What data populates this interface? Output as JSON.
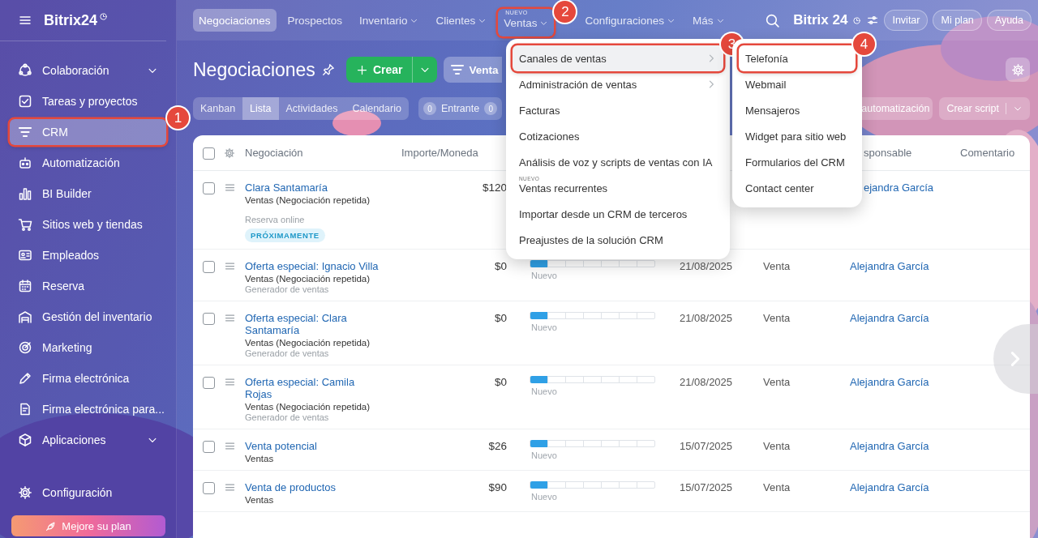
{
  "sidebar": {
    "logo": "Bitrix24",
    "items": [
      {
        "label": "Colaboración",
        "expandable": true,
        "selected": false
      },
      {
        "label": "Tareas y proyectos",
        "expandable": false,
        "selected": false
      },
      {
        "label": "CRM",
        "expandable": false,
        "selected": true,
        "callout": "1"
      },
      {
        "label": "Automatización",
        "expandable": false,
        "selected": false
      },
      {
        "label": "BI Builder",
        "expandable": false,
        "selected": false
      },
      {
        "label": "Sitios web y tiendas",
        "expandable": false,
        "selected": false
      },
      {
        "label": "Empleados",
        "expandable": false,
        "selected": false
      },
      {
        "label": "Reserva",
        "expandable": false,
        "selected": false
      },
      {
        "label": "Gestión del inventario",
        "expandable": false,
        "selected": false
      },
      {
        "label": "Marketing",
        "expandable": false,
        "selected": false
      },
      {
        "label": "Firma electrónica",
        "expandable": false,
        "selected": false
      },
      {
        "label": "Firma electrónica para...",
        "expandable": false,
        "selected": false
      },
      {
        "label": "Aplicaciones",
        "expandable": true,
        "selected": false
      }
    ],
    "settings": "Configuración",
    "upgrade": "Mejore su plan"
  },
  "topnav": {
    "items": [
      {
        "label": "Negociaciones",
        "selected": true,
        "dropdown": false
      },
      {
        "label": "Prospectos",
        "selected": false,
        "dropdown": false
      },
      {
        "label": "Inventario",
        "selected": false,
        "dropdown": true
      },
      {
        "label": "Clientes",
        "selected": false,
        "dropdown": true
      },
      {
        "label": "Ventas",
        "selected": false,
        "dropdown": true,
        "badge": "NUEVO",
        "callout": "2"
      },
      {
        "label": "Configuraciones",
        "selected": false,
        "dropdown": true
      },
      {
        "label": "Más",
        "selected": false,
        "dropdown": true
      }
    ],
    "brand": "Bitrix 24",
    "buttons": [
      "Invitar",
      "Mi plan",
      "Ayuda"
    ]
  },
  "header": {
    "title": "Negociaciones",
    "create": "Crear",
    "filter": "Venta"
  },
  "views": [
    {
      "label": "Kanban",
      "selected": false
    },
    {
      "label": "Lista",
      "selected": true
    },
    {
      "label": "Actividades",
      "selected": false
    },
    {
      "label": "Calendario",
      "selected": false
    }
  ],
  "counters": {
    "incoming": "0",
    "label": "Entrante",
    "other": "0"
  },
  "actions": [
    {
      "label": "automatización",
      "dropdown": false
    },
    {
      "label": "Crear script",
      "dropdown": true
    }
  ],
  "table": {
    "select_all_checked": false,
    "columns": [
      {
        "label": "Negociación",
        "kind": "full"
      },
      {
        "label": "Importe/Moneda",
        "kind": "full"
      },
      {
        "label": "sponsable",
        "kind": "clipped"
      },
      {
        "label": "Comentario",
        "kind": "full"
      }
    ],
    "rows": [
      {
        "checked": false,
        "title": "Clara Santamaría",
        "subtitle": "Ventas (Negociación repetida)",
        "source": "Reserva online",
        "badge": "PRÓXIMAMENTE",
        "amount": "$120",
        "responsible": {
          "text": "ejandra García",
          "kind": "clipped"
        }
      },
      {
        "checked": false,
        "title": "Oferta especial: Ignacio Villa",
        "subtitle": "Ventas (Negociación repetida)",
        "source": "Generador de ventas",
        "amount": "$0",
        "stage": {
          "level": 0.14,
          "label": "Nuevo"
        },
        "date": "21/08/2025",
        "pipeline": "Venta",
        "responsible": {
          "text": "Alejandra García",
          "kind": "full"
        }
      },
      {
        "checked": false,
        "title": "Oferta especial: Clara Santamaría",
        "subtitle": "Ventas (Negociación repetida)",
        "source": "Generador de ventas",
        "amount": "$0",
        "stage": {
          "level": 0.14,
          "label": "Nuevo"
        },
        "date": "21/08/2025",
        "pipeline": "Venta",
        "responsible": {
          "text": "Alejandra García",
          "kind": "full"
        }
      },
      {
        "checked": false,
        "title": "Oferta especial: Camila Rojas",
        "subtitle": "Ventas (Negociación repetida)",
        "source": "Generador de ventas",
        "amount": "$0",
        "stage": {
          "level": 0.14,
          "label": "Nuevo"
        },
        "date": "21/08/2025",
        "pipeline": "Venta",
        "responsible": {
          "text": "Alejandra García",
          "kind": "full"
        }
      },
      {
        "checked": false,
        "title": "Venta potencial",
        "subtitle": "Ventas",
        "amount": "$26",
        "stage": {
          "level": 0.14,
          "label": "Nuevo"
        },
        "date": "15/07/2025",
        "pipeline": "Venta",
        "responsible": {
          "text": "Alejandra García",
          "kind": "full"
        }
      },
      {
        "checked": false,
        "title": "Venta de productos",
        "subtitle": "Ventas",
        "amount": "$90",
        "stage": {
          "level": 0.14,
          "label": "Nuevo"
        },
        "date": "15/07/2025",
        "pipeline": "Venta",
        "responsible": {
          "text": "Alejandra García",
          "kind": "full"
        }
      }
    ]
  },
  "menu": {
    "items": [
      {
        "label": "Canales de ventas",
        "submenu": true,
        "selected": true,
        "callout": "3"
      },
      {
        "label": "Administración de ventas",
        "submenu": true,
        "selected": false
      },
      {
        "label": "Facturas",
        "submenu": false,
        "selected": false
      },
      {
        "label": "Cotizaciones",
        "submenu": false,
        "selected": false
      },
      {
        "label": "Análisis de voz y scripts de ventas con IA",
        "submenu": false,
        "selected": false
      },
      {
        "label": "Ventas recurrentes",
        "submenu": false,
        "selected": false,
        "badge": "NUEVO"
      },
      {
        "label": "Importar desde un CRM de terceros",
        "submenu": false,
        "selected": false
      },
      {
        "label": "Preajustes de la solución CRM",
        "submenu": false,
        "selected": false
      }
    ]
  },
  "submenu": {
    "items": [
      {
        "label": "Telefonía",
        "callout": "4"
      },
      {
        "label": "Webmail"
      },
      {
        "label": "Mensajeros"
      },
      {
        "label": "Widget para sitio web"
      },
      {
        "label": "Formularios del CRM"
      },
      {
        "label": "Contact center"
      }
    ]
  }
}
